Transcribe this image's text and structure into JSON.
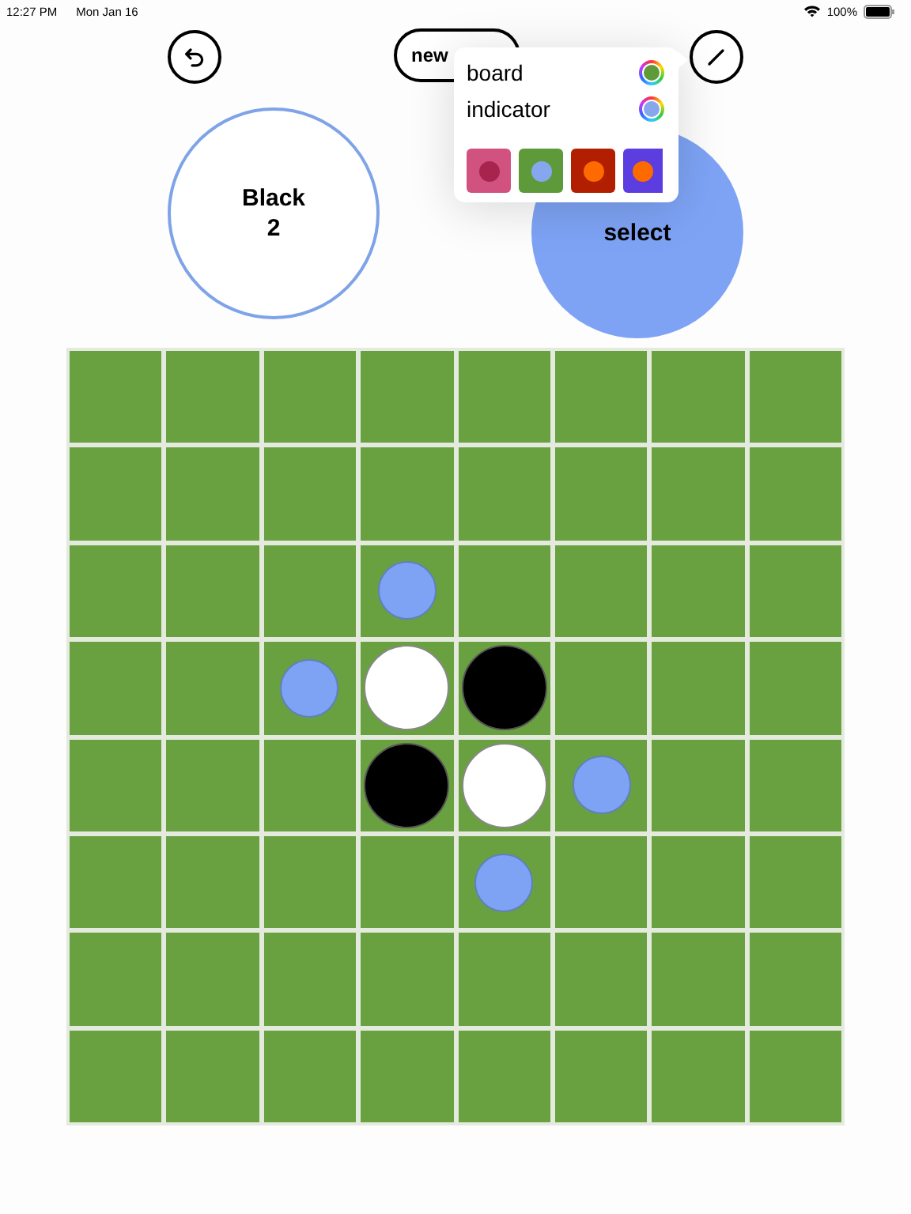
{
  "status_bar": {
    "time": "12:27 PM",
    "date": "Mon Jan 16",
    "battery": "100%"
  },
  "toolbar": {
    "new_button": "new"
  },
  "players": [
    {
      "name": "Black",
      "score": "2",
      "kind": "score"
    },
    {
      "name": "select",
      "kind": "prompt"
    }
  ],
  "color_menu": {
    "items": [
      {
        "label": "board",
        "color": "#5f9a3a"
      },
      {
        "label": "indicator",
        "color": "#86a7ee"
      }
    ],
    "swatches": [
      {
        "color": "#d2527f",
        "dot": {
          "color": "#a8244f"
        }
      },
      {
        "color": "#5f9a3a",
        "dot": {
          "color": "#86a7ee"
        }
      },
      {
        "color": "#b21f00",
        "dot": {
          "color": "#ff6a00"
        }
      },
      {
        "color": "#5b3de0",
        "dot": {
          "color": "#ff6a00"
        }
      }
    ]
  },
  "board": {
    "color": "#69a040",
    "indicator": {
      "color": "#7ea3f5"
    },
    "rows": [
      {
        "cells": [
          {
            "kind": "empty"
          },
          {
            "kind": "empty"
          },
          {
            "kind": "empty"
          },
          {
            "kind": "empty"
          },
          {
            "kind": "empty"
          },
          {
            "kind": "empty"
          },
          {
            "kind": "empty"
          },
          {
            "kind": "empty"
          }
        ]
      },
      {
        "cells": [
          {
            "kind": "empty"
          },
          {
            "kind": "empty"
          },
          {
            "kind": "empty"
          },
          {
            "kind": "empty"
          },
          {
            "kind": "empty"
          },
          {
            "kind": "empty"
          },
          {
            "kind": "empty"
          },
          {
            "kind": "empty"
          }
        ]
      },
      {
        "cells": [
          {
            "kind": "empty"
          },
          {
            "kind": "empty"
          },
          {
            "kind": "empty"
          },
          {
            "kind": "hint"
          },
          {
            "kind": "empty"
          },
          {
            "kind": "empty"
          },
          {
            "kind": "empty"
          },
          {
            "kind": "empty"
          }
        ]
      },
      {
        "cells": [
          {
            "kind": "empty"
          },
          {
            "kind": "empty"
          },
          {
            "kind": "hint"
          },
          {
            "kind": "white"
          },
          {
            "kind": "black"
          },
          {
            "kind": "empty"
          },
          {
            "kind": "empty"
          },
          {
            "kind": "empty"
          }
        ]
      },
      {
        "cells": [
          {
            "kind": "empty"
          },
          {
            "kind": "empty"
          },
          {
            "kind": "empty"
          },
          {
            "kind": "black"
          },
          {
            "kind": "white"
          },
          {
            "kind": "hint"
          },
          {
            "kind": "empty"
          },
          {
            "kind": "empty"
          }
        ]
      },
      {
        "cells": [
          {
            "kind": "empty"
          },
          {
            "kind": "empty"
          },
          {
            "kind": "empty"
          },
          {
            "kind": "empty"
          },
          {
            "kind": "hint"
          },
          {
            "kind": "empty"
          },
          {
            "kind": "empty"
          },
          {
            "kind": "empty"
          }
        ]
      },
      {
        "cells": [
          {
            "kind": "empty"
          },
          {
            "kind": "empty"
          },
          {
            "kind": "empty"
          },
          {
            "kind": "empty"
          },
          {
            "kind": "empty"
          },
          {
            "kind": "empty"
          },
          {
            "kind": "empty"
          },
          {
            "kind": "empty"
          }
        ]
      },
      {
        "cells": [
          {
            "kind": "empty"
          },
          {
            "kind": "empty"
          },
          {
            "kind": "empty"
          },
          {
            "kind": "empty"
          },
          {
            "kind": "empty"
          },
          {
            "kind": "empty"
          },
          {
            "kind": "empty"
          },
          {
            "kind": "empty"
          }
        ]
      }
    ]
  }
}
